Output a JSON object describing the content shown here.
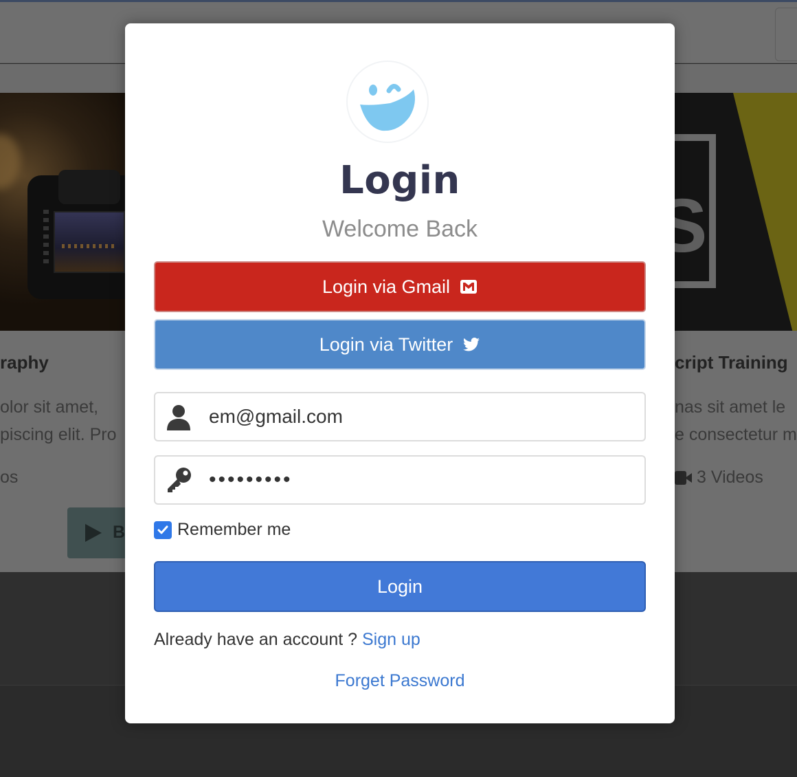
{
  "background": {
    "card_left": {
      "title": "raphy",
      "description": "olor sit amet,\npiscing elit. Pro",
      "videos": "os",
      "button_letter": "B"
    },
    "card_right": {
      "title": "cript Training",
      "description": "nas sit amet le\ne consectetur m",
      "videos": "3 Videos"
    }
  },
  "modal": {
    "logo_icon": "winking-smiley-icon",
    "title": "Login",
    "subtitle": "Welcome Back",
    "gmail_button": {
      "label": "Login via Gmail",
      "icon": "mail-icon",
      "color": "#c9261d"
    },
    "twitter_button": {
      "label": "Login via Twitter",
      "icon": "twitter-bird-icon",
      "color": "#4f88c9"
    },
    "email_field": {
      "value": "em@gmail.com",
      "icon": "user-icon"
    },
    "password_field": {
      "value": "•••••••••",
      "icon": "key-icon"
    },
    "remember_me": {
      "label": "Remember me",
      "checked": true
    },
    "login_button": {
      "label": "Login",
      "color": "#4279d7"
    },
    "signup_prompt": "Already have an account ?",
    "signup_link": "Sign up",
    "forget_password": "Forget Password"
  }
}
